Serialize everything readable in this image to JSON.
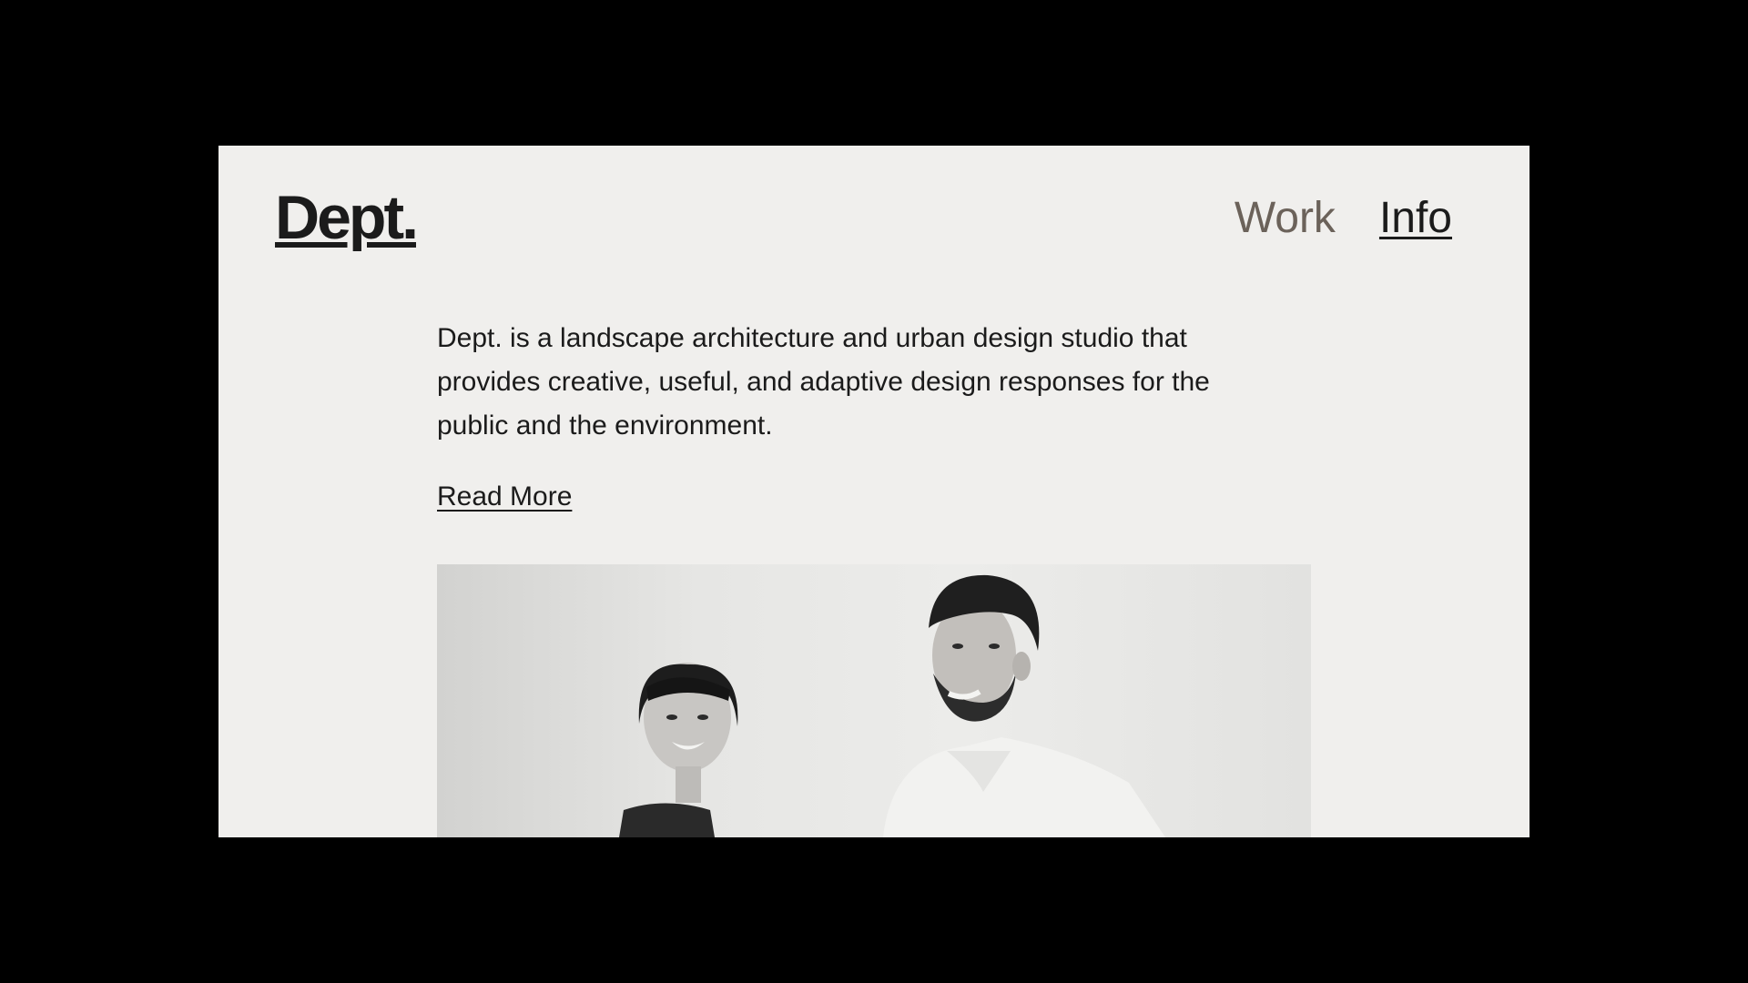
{
  "header": {
    "logo_text": "Dept.",
    "nav": {
      "work_label": "Work",
      "info_label": "Info"
    }
  },
  "main": {
    "intro_text": "Dept. is a landscape architecture and urban design studio that provides creative, useful, and adaptive design responses for the public and the environment.",
    "read_more_label": "Read More",
    "photo": {
      "description": "Black-and-white portrait of two smiling people against a light wall"
    }
  },
  "colors": {
    "page_background": "#f0efed",
    "outer_background": "#000000",
    "text": "#1b1b1b",
    "nav_inactive": "#6b625a"
  }
}
